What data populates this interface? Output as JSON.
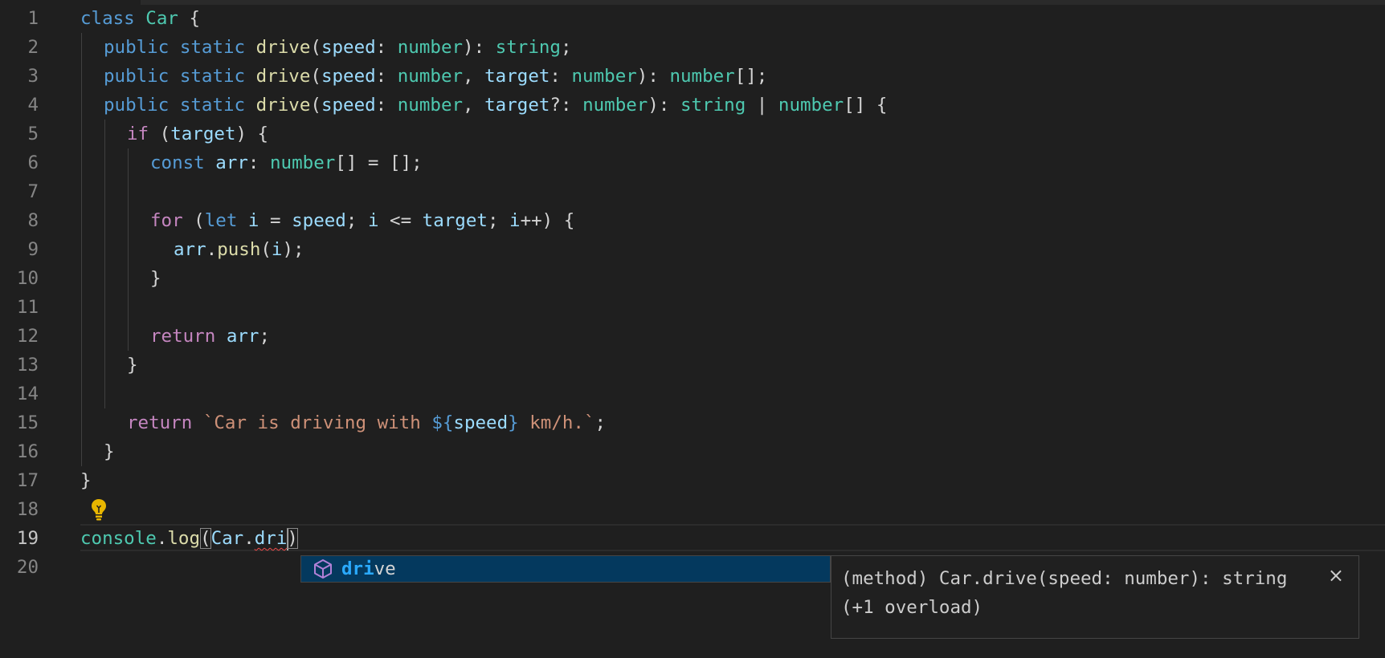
{
  "editor": {
    "line_numbers": [
      "1",
      "2",
      "3",
      "4",
      "5",
      "6",
      "7",
      "8",
      "9",
      "10",
      "11",
      "12",
      "13",
      "14",
      "15",
      "16",
      "17",
      "18",
      "19",
      "20"
    ],
    "active_line": "19",
    "lines": {
      "l1": {
        "kw_class": "class",
        "cls": "Car",
        "brace": "{"
      },
      "l2": {
        "kw_public": "public",
        "kw_static": "static",
        "fn": "drive",
        "p1": "(",
        "param": "speed",
        "c1": ": ",
        "type1": "number",
        "p2": "): ",
        "ret": "string",
        "end": ";"
      },
      "l3": {
        "kw_public": "public",
        "kw_static": "static",
        "fn": "drive",
        "p1": "(",
        "param1": "speed",
        "c1": ": ",
        "type1": "number",
        "c2": ", ",
        "param2": "target",
        "c3": ": ",
        "type2": "number",
        "p2": "): ",
        "ret": "number",
        "end": "[];"
      },
      "l4": {
        "kw_public": "public",
        "kw_static": "static",
        "fn": "drive",
        "p1": "(",
        "param1": "speed",
        "c1": ": ",
        "type1": "number",
        "c2": ", ",
        "param2": "target",
        "c3": "?: ",
        "type2": "number",
        "p2": "): ",
        "ret1": "string",
        "pipe": " | ",
        "ret2": "number",
        "end": "[] {"
      },
      "l5": {
        "kw_if": "if",
        "p1": " (",
        "var": "target",
        "end": ") {"
      },
      "l6": {
        "kw_const": "const",
        "var": "arr",
        "c1": ": ",
        "type": "number",
        "end": "[] = [];"
      },
      "l8": {
        "kw_for": "for",
        "p1": " (",
        "kw_let": "let",
        "v1": "i",
        "op1": " = ",
        "v2": "speed",
        "s1": "; ",
        "v3": "i",
        "op2": " <= ",
        "v4": "target",
        "s2": "; ",
        "v5": "i",
        "end": "++) {"
      },
      "l9": {
        "var": "arr",
        "dot": ".",
        "fn": "push",
        "p1": "(",
        "arg": "i",
        "end": ");"
      },
      "l10": {
        "brace": "}"
      },
      "l12": {
        "kw_return": "return",
        "var": "arr",
        "end": ";"
      },
      "l13": {
        "brace": "}"
      },
      "l15": {
        "kw_return": "return",
        "str1": "`Car is driving with ",
        "tpl_open": "${",
        "var": "speed",
        "tpl_close": "}",
        "str2": " km/h.`",
        "end": ";"
      },
      "l16": {
        "brace": "}"
      },
      "l17": {
        "brace": "}"
      },
      "l19": {
        "obj": "console",
        "dot1": ".",
        "fn": "log",
        "p_open": "(",
        "cls": "Car",
        "dot2": ".",
        "partial": "dri",
        "p_close": ")"
      }
    }
  },
  "autocomplete": {
    "item_icon": "method-cube-icon",
    "item_match": "dri",
    "item_rest": "ve",
    "detail_line1": "(method) Car.drive(speed: number): string",
    "detail_line2": "(+1 overload)",
    "close_glyph": "×"
  },
  "lightbulb": {
    "icon": "lightbulb-icon",
    "color": "#e8b600"
  },
  "colors": {
    "background": "#1f1f1f",
    "keyword": "#569cd6",
    "control": "#c586c0",
    "type": "#4ec9b0",
    "function": "#dcdcaa",
    "variable": "#9cdcfe",
    "string": "#ce9178",
    "selection": "#04395e",
    "match_highlight": "#2aaaff"
  }
}
